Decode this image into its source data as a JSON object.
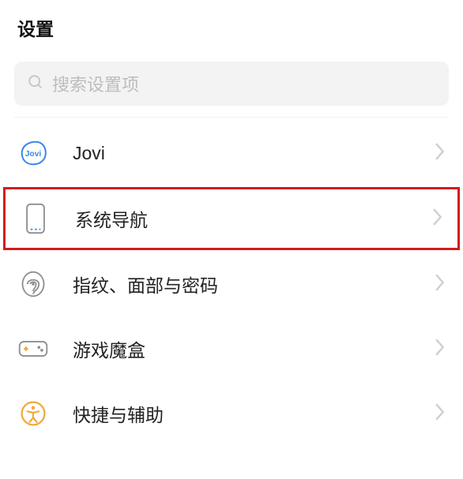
{
  "header": {
    "title": "设置"
  },
  "search": {
    "placeholder": "搜索设置项"
  },
  "items": [
    {
      "label": "Jovi"
    },
    {
      "label": "系统导航"
    },
    {
      "label": "指纹、面部与密码"
    },
    {
      "label": "游戏魔盒"
    },
    {
      "label": "快捷与辅助"
    }
  ],
  "colors": {
    "jovi": "#3a86e8",
    "accessibility": "#f2a93c",
    "highlight": "#d21c1c"
  }
}
